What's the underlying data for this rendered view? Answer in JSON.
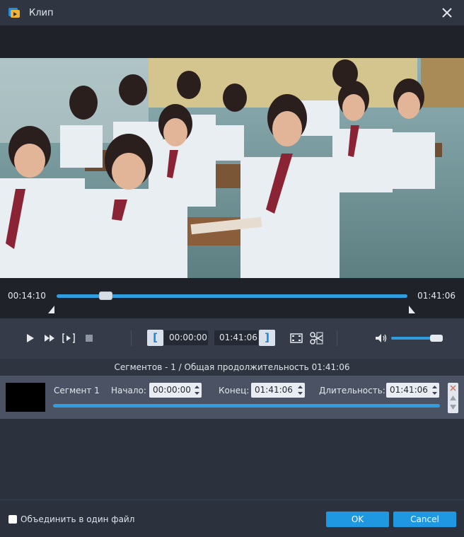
{
  "window": {
    "title": "Клип"
  },
  "player": {
    "current_time": "00:14:10",
    "total_time": "01:41:06",
    "progress": 0.14
  },
  "clip": {
    "start_time": "00:00:00",
    "end_time": "01:41:06",
    "start_bracket": "[",
    "end_bracket": "]"
  },
  "volume": {
    "level": 0.9
  },
  "summary": "Сегментов - 1 / Общая продолжительность 01:41:06",
  "segment": {
    "name": "Сегмент 1",
    "start_label": "Начало:",
    "start_value": "00:00:00",
    "end_label": "Конец:",
    "end_value": "01:41:06",
    "duration_label": "Длительность:",
    "duration_value": "01:41:06"
  },
  "footer": {
    "merge_label": "Объединить в один файл",
    "merge_checked": false,
    "ok_label": "OK",
    "cancel_label": "Cancel"
  },
  "colors": {
    "accent": "#1f97e1",
    "track": "#2f9ee0",
    "background": "#2b313d"
  },
  "icons": [
    "app-icon",
    "close-icon",
    "play-icon",
    "fast-forward-icon",
    "next-frame-icon",
    "stop-icon",
    "crop-icon",
    "cut-icon",
    "volume-icon",
    "delete-icon",
    "move-up-icon",
    "move-down-icon"
  ]
}
